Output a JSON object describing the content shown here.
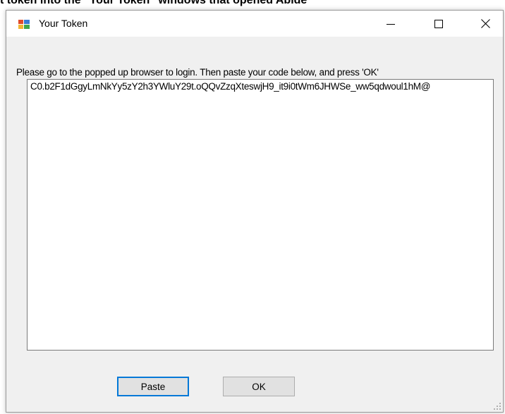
{
  "page": {
    "caption": "t token into the \"Your Token\" windows that opened Abide"
  },
  "window": {
    "title": "Your Token",
    "controls": {
      "minimize": "minimize",
      "maximize": "maximize",
      "close": "close"
    }
  },
  "form": {
    "instruction": "Please go to the popped up browser to login. Then paste your code below, and press 'OK'",
    "token_value": "C0.b2F1dGgyLmNkYy5zY2h3YWluY29t.oQQvZzqXteswjH9_it9i0tWm6JHWSe_ww5qdwoul1hM@"
  },
  "buttons": {
    "paste_label": "Paste",
    "ok_label": "OK"
  },
  "colors": {
    "accent": "#0078d7",
    "window_bg": "#f0f0f0",
    "button_bg": "#e1e1e1"
  }
}
